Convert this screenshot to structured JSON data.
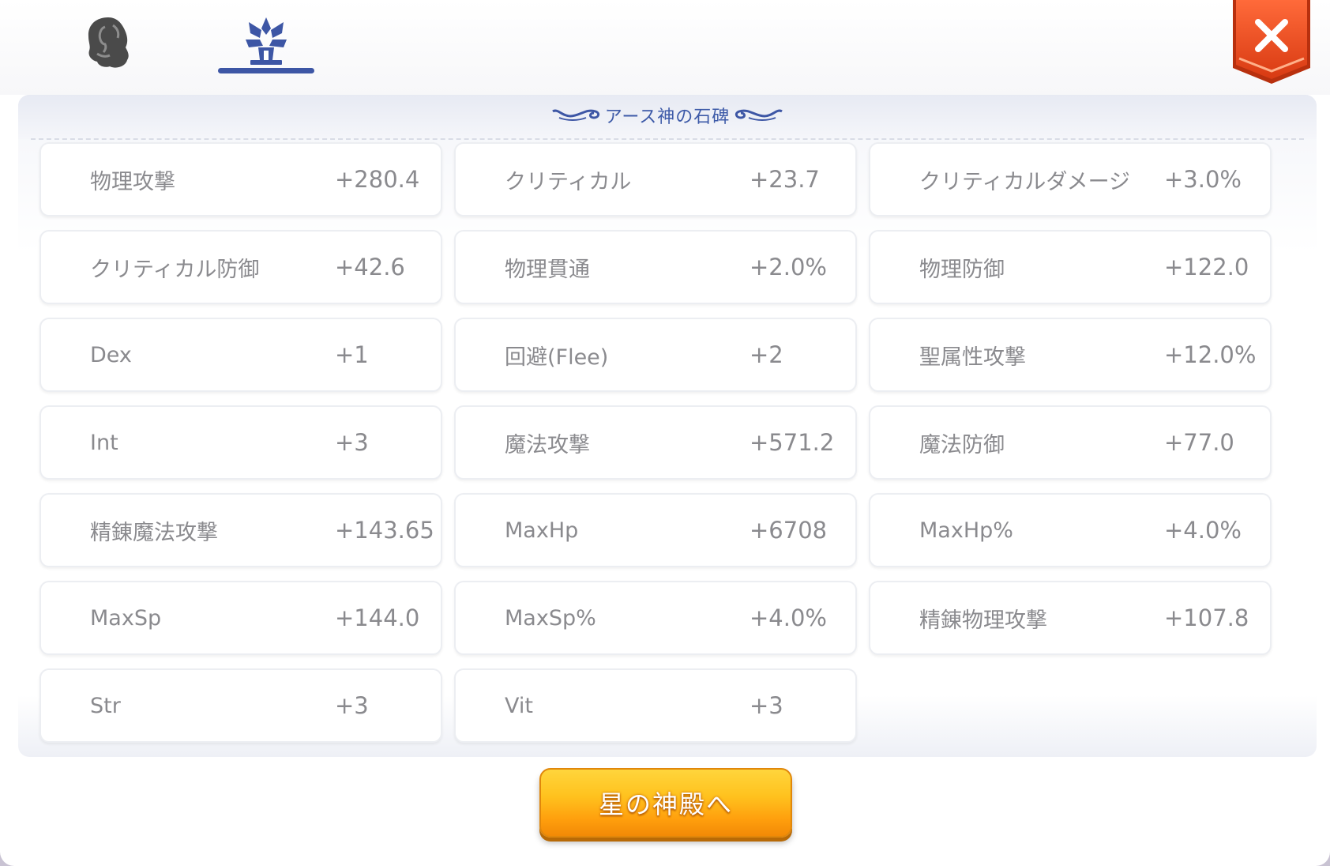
{
  "tabs": [
    {
      "icon": "character-silhouette-icon"
    },
    {
      "icon": "temple-emblem-icon",
      "active": true
    }
  ],
  "close": {
    "icon": "close-icon"
  },
  "panel": {
    "title": "アース神の石碑"
  },
  "stats": [
    {
      "name": "物理攻撃",
      "value": "+280.4"
    },
    {
      "name": "クリティカル",
      "value": "+23.7"
    },
    {
      "name": "クリティカルダメージ",
      "value": "+3.0%"
    },
    {
      "name": "クリティカル防御",
      "value": "+42.6"
    },
    {
      "name": "物理貫通",
      "value": "+2.0%"
    },
    {
      "name": "物理防御",
      "value": "+122.0"
    },
    {
      "name": "Dex",
      "value": "+1"
    },
    {
      "name": "回避(Flee)",
      "value": "+2"
    },
    {
      "name": "聖属性攻撃",
      "value": "+12.0%"
    },
    {
      "name": "Int",
      "value": "+3"
    },
    {
      "name": "魔法攻撃",
      "value": "+571.2"
    },
    {
      "name": "魔法防御",
      "value": "+77.0"
    },
    {
      "name": "精錬魔法攻撃",
      "value": "+143.65"
    },
    {
      "name": "MaxHp",
      "value": "+6708"
    },
    {
      "name": "MaxHp%",
      "value": "+4.0%"
    },
    {
      "name": "MaxSp",
      "value": "+144.0"
    },
    {
      "name": "MaxSp%",
      "value": "+4.0%"
    },
    {
      "name": "精錬物理攻撃",
      "value": "+107.8"
    },
    {
      "name": "Str",
      "value": "+3"
    },
    {
      "name": "Vit",
      "value": "+3"
    }
  ],
  "button": {
    "label": "星の神殿へ"
  },
  "colors": {
    "accent": "#3d56a5",
    "close_red": "#e64a19",
    "button_orange": "#ff9f0d",
    "text_gray": "#8a8a8e"
  }
}
